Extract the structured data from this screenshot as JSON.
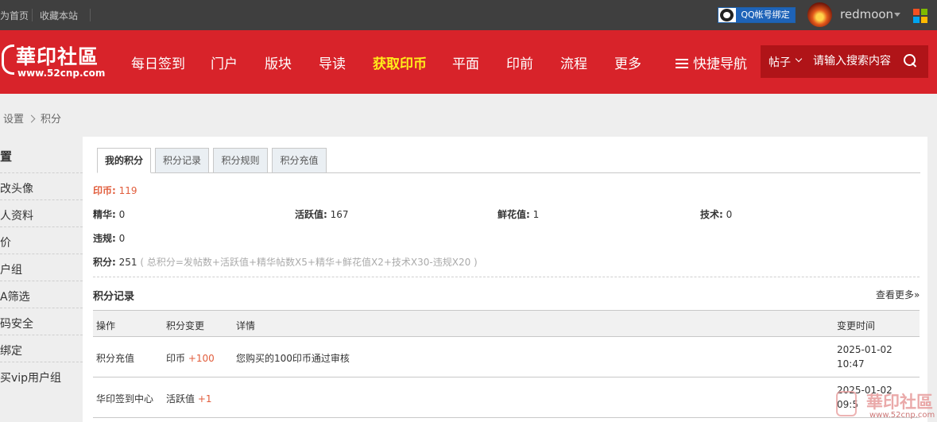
{
  "topbar": {
    "home": "设为首页",
    "home_visible": "为首页",
    "bookmark": "收藏本站",
    "qq_bind": "QQ帐号绑定",
    "username": "redmoon"
  },
  "logo": {
    "name": "華印社區",
    "url": "www.52cnp.com"
  },
  "nav": {
    "items": [
      "每日签到",
      "门户",
      "版块",
      "导读",
      "获取印币",
      "平面",
      "印前",
      "流程",
      "更多"
    ],
    "quick_nav": "快捷导航",
    "search_type": "帖子",
    "search_placeholder": "请输入搜索内容"
  },
  "breadcrumb": {
    "parent": "设置",
    "current": "积分"
  },
  "sidebar": {
    "title": "置",
    "items": [
      "改头像",
      "人资料",
      "价",
      "户组",
      "A筛选",
      "码安全",
      "绑定",
      "买vip用户组"
    ]
  },
  "tabs": [
    "我的积分",
    "积分记录",
    "积分规则",
    "积分充值"
  ],
  "credits": {
    "yinbi_label": "印币:",
    "yinbi_value": "119",
    "jinghua_label": "精华:",
    "jinghua_value": "0",
    "huoyue_label": "活跃值:",
    "huoyue_value": "167",
    "xianhua_label": "鲜花值:",
    "xianhua_value": "1",
    "jishu_label": "技术:",
    "jishu_value": "0",
    "weigui_label": "违规:",
    "weigui_value": "0",
    "total_label": "积分:",
    "total_value": "251",
    "total_formula": "( 总积分=发帖数+活跃值+精华帖数X5+精华+鲜花值X2+技术X30-违规X20 )"
  },
  "record_section": {
    "title": "积分记录",
    "view_more": "查看更多»"
  },
  "table": {
    "headers": [
      "操作",
      "积分变更",
      "详情",
      "变更时间"
    ],
    "rows": [
      {
        "op": "积分充值",
        "currency": "印币",
        "change": "+100",
        "detail": "您购买的100印币通过审核",
        "date": "2025-01-02",
        "time": "10:47"
      },
      {
        "op": "华印签到中心",
        "currency": "活跃值",
        "change": "+1",
        "detail": "",
        "date": "2025-01-02",
        "time": "09:5"
      }
    ]
  },
  "watermark": {
    "name": "華印社區",
    "url": "www.52cnp.com"
  },
  "colors": {
    "nav_red": "#d8232a",
    "highlight_yellow": "#ffec1a",
    "value_red": "#e15d3c",
    "topbar_dark": "#3f3f3f"
  }
}
